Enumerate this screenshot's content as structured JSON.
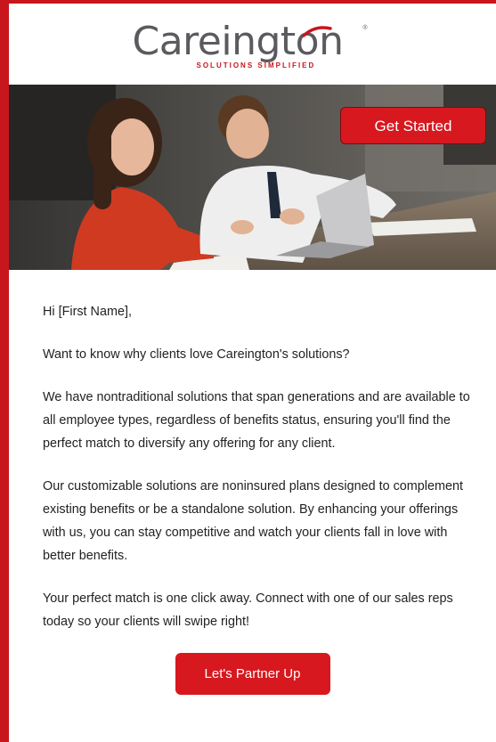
{
  "header": {
    "logo_word": "Careington",
    "logo_reg": "®",
    "tagline": "SOLUTIONS   SIMPLIFIED"
  },
  "hero": {
    "cta_label": "Get Started"
  },
  "email": {
    "greeting": "Hi [First Name],",
    "paragraphs": [
      "Want to know why clients love Careington's solutions?",
      "We have nontraditional solutions that span generations and are available to all employee types, regardless of benefits status, ensuring you'll find the perfect match to diversify any offering for any client.",
      "Our customizable solutions are noninsured plans designed to complement existing benefits or be a standalone solution. By enhancing your offerings with us, you can stay competitive and watch your clients fall in love with better benefits.",
      "Your perfect match is one click away. Connect with one of our sales reps today so your clients will swipe right!"
    ],
    "cta_label": "Let's Partner Up"
  },
  "colors": {
    "brand_red": "#c8161d",
    "button_red": "#d7181f",
    "logo_gray": "#5b5b5f",
    "text": "#222222"
  },
  "icons": {
    "hero_image": "two-business-people-laptop-photo"
  }
}
